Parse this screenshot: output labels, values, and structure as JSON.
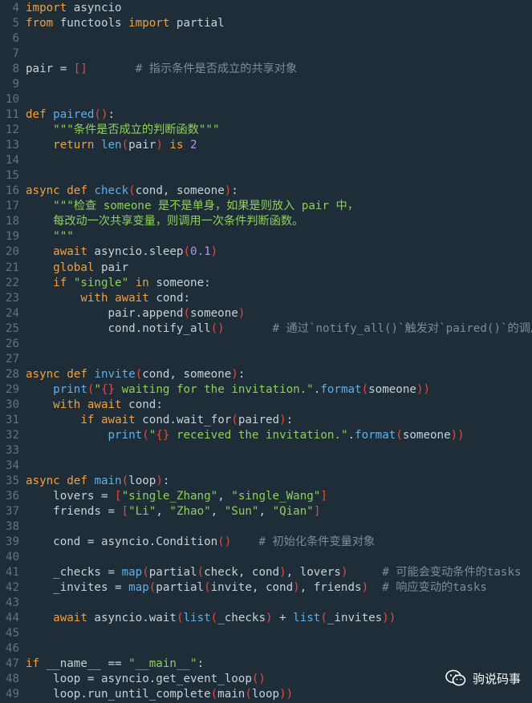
{
  "editor": {
    "language": "python",
    "lines": [
      {
        "n": "4",
        "tokens": [
          {
            "t": "import",
            "c": "kw"
          },
          {
            "t": " asyncio",
            "c": "code"
          }
        ]
      },
      {
        "n": "5",
        "tokens": [
          {
            "t": "from",
            "c": "kw"
          },
          {
            "t": " functools ",
            "c": "code"
          },
          {
            "t": "import",
            "c": "kw"
          },
          {
            "t": " partial",
            "c": "code"
          }
        ]
      },
      {
        "n": "6",
        "tokens": []
      },
      {
        "n": "7",
        "tokens": []
      },
      {
        "n": "8",
        "tokens": [
          {
            "t": "pair = ",
            "c": "code"
          },
          {
            "t": "[]",
            "c": "br"
          },
          {
            "t": "       ",
            "c": "code"
          },
          {
            "t": "# 指示条件是否成立的共享对象",
            "c": "cmt"
          }
        ]
      },
      {
        "n": "9",
        "tokens": []
      },
      {
        "n": "10",
        "tokens": []
      },
      {
        "n": "11",
        "tokens": [
          {
            "t": "def",
            "c": "kw"
          },
          {
            "t": " ",
            "c": "code"
          },
          {
            "t": "paired",
            "c": "fn"
          },
          {
            "t": "()",
            "c": "br"
          },
          {
            "t": ":",
            "c": "code"
          }
        ]
      },
      {
        "n": "12",
        "tokens": [
          {
            "t": "    ",
            "c": "code"
          },
          {
            "t": "\"\"\"条件是否成立的判断函数\"\"\"",
            "c": "str"
          }
        ]
      },
      {
        "n": "13",
        "tokens": [
          {
            "t": "    ",
            "c": "code"
          },
          {
            "t": "return",
            "c": "kw"
          },
          {
            "t": " ",
            "c": "code"
          },
          {
            "t": "len",
            "c": "fn"
          },
          {
            "t": "(",
            "c": "br"
          },
          {
            "t": "pair",
            "c": "code"
          },
          {
            "t": ")",
            "c": "br"
          },
          {
            "t": " ",
            "c": "code"
          },
          {
            "t": "is",
            "c": "kw"
          },
          {
            "t": " ",
            "c": "code"
          },
          {
            "t": "2",
            "c": "num"
          }
        ]
      },
      {
        "n": "14",
        "tokens": []
      },
      {
        "n": "15",
        "tokens": []
      },
      {
        "n": "16",
        "tokens": [
          {
            "t": "async",
            "c": "kw"
          },
          {
            "t": " ",
            "c": "code"
          },
          {
            "t": "def",
            "c": "kw"
          },
          {
            "t": " ",
            "c": "code"
          },
          {
            "t": "check",
            "c": "fn"
          },
          {
            "t": "(",
            "c": "br"
          },
          {
            "t": "cond, someone",
            "c": "code"
          },
          {
            "t": ")",
            "c": "br"
          },
          {
            "t": ":",
            "c": "code"
          }
        ]
      },
      {
        "n": "17",
        "tokens": [
          {
            "t": "    ",
            "c": "code"
          },
          {
            "t": "\"\"\"检查 someone 是不是单身，如果是则放入 pair 中，",
            "c": "str"
          }
        ]
      },
      {
        "n": "18",
        "tokens": [
          {
            "t": "    ",
            "c": "code"
          },
          {
            "t": "每改动一次共享变量，则调用一次条件判断函数。",
            "c": "str"
          }
        ]
      },
      {
        "n": "19",
        "tokens": [
          {
            "t": "    ",
            "c": "code"
          },
          {
            "t": "\"\"\"",
            "c": "str"
          }
        ]
      },
      {
        "n": "20",
        "tokens": [
          {
            "t": "    ",
            "c": "code"
          },
          {
            "t": "await",
            "c": "kw"
          },
          {
            "t": " asyncio.sleep",
            "c": "code"
          },
          {
            "t": "(",
            "c": "br"
          },
          {
            "t": "0.1",
            "c": "num"
          },
          {
            "t": ")",
            "c": "br"
          }
        ]
      },
      {
        "n": "21",
        "tokens": [
          {
            "t": "    ",
            "c": "code"
          },
          {
            "t": "global",
            "c": "kw"
          },
          {
            "t": " pair",
            "c": "code"
          }
        ]
      },
      {
        "n": "22",
        "tokens": [
          {
            "t": "    ",
            "c": "code"
          },
          {
            "t": "if",
            "c": "kw"
          },
          {
            "t": " ",
            "c": "code"
          },
          {
            "t": "\"single\"",
            "c": "str"
          },
          {
            "t": " ",
            "c": "code"
          },
          {
            "t": "in",
            "c": "kw"
          },
          {
            "t": " someone:",
            "c": "code"
          }
        ]
      },
      {
        "n": "23",
        "tokens": [
          {
            "t": "        ",
            "c": "code"
          },
          {
            "t": "with",
            "c": "kw"
          },
          {
            "t": " ",
            "c": "code"
          },
          {
            "t": "await",
            "c": "kw"
          },
          {
            "t": " cond:",
            "c": "code"
          }
        ]
      },
      {
        "n": "24",
        "tokens": [
          {
            "t": "            pair.append",
            "c": "code"
          },
          {
            "t": "(",
            "c": "br"
          },
          {
            "t": "someone",
            "c": "code"
          },
          {
            "t": ")",
            "c": "br"
          }
        ]
      },
      {
        "n": "25",
        "tokens": [
          {
            "t": "            cond.notify_all",
            "c": "code"
          },
          {
            "t": "()",
            "c": "br"
          },
          {
            "t": "       ",
            "c": "code"
          },
          {
            "t": "# 通过`notify_all()`触发对`paired()`的调用",
            "c": "cmt"
          }
        ]
      },
      {
        "n": "26",
        "tokens": []
      },
      {
        "n": "27",
        "tokens": []
      },
      {
        "n": "28",
        "tokens": [
          {
            "t": "async",
            "c": "kw"
          },
          {
            "t": " ",
            "c": "code"
          },
          {
            "t": "def",
            "c": "kw"
          },
          {
            "t": " ",
            "c": "code"
          },
          {
            "t": "invite",
            "c": "fn"
          },
          {
            "t": "(",
            "c": "br"
          },
          {
            "t": "cond, someone",
            "c": "code"
          },
          {
            "t": ")",
            "c": "br"
          },
          {
            "t": ":",
            "c": "code"
          }
        ]
      },
      {
        "n": "29",
        "tokens": [
          {
            "t": "    ",
            "c": "code"
          },
          {
            "t": "print",
            "c": "fn"
          },
          {
            "t": "(",
            "c": "br"
          },
          {
            "t": "\"",
            "c": "str"
          },
          {
            "t": "{}",
            "c": "br"
          },
          {
            "t": " waiting for the invitation.\"",
            "c": "str"
          },
          {
            "t": ".",
            "c": "code"
          },
          {
            "t": "format",
            "c": "fn"
          },
          {
            "t": "(",
            "c": "br"
          },
          {
            "t": "someone",
            "c": "code"
          },
          {
            "t": "))",
            "c": "br"
          }
        ]
      },
      {
        "n": "30",
        "tokens": [
          {
            "t": "    ",
            "c": "code"
          },
          {
            "t": "with",
            "c": "kw"
          },
          {
            "t": " ",
            "c": "code"
          },
          {
            "t": "await",
            "c": "kw"
          },
          {
            "t": " cond:",
            "c": "code"
          }
        ]
      },
      {
        "n": "31",
        "tokens": [
          {
            "t": "        ",
            "c": "code"
          },
          {
            "t": "if",
            "c": "kw"
          },
          {
            "t": " ",
            "c": "code"
          },
          {
            "t": "await",
            "c": "kw"
          },
          {
            "t": " cond.wait_for",
            "c": "code"
          },
          {
            "t": "(",
            "c": "br"
          },
          {
            "t": "paired",
            "c": "code"
          },
          {
            "t": ")",
            "c": "br"
          },
          {
            "t": ":",
            "c": "code"
          }
        ]
      },
      {
        "n": "32",
        "tokens": [
          {
            "t": "            ",
            "c": "code"
          },
          {
            "t": "print",
            "c": "fn"
          },
          {
            "t": "(",
            "c": "br"
          },
          {
            "t": "\"",
            "c": "str"
          },
          {
            "t": "{}",
            "c": "br"
          },
          {
            "t": " received the invitation.\"",
            "c": "str"
          },
          {
            "t": ".",
            "c": "code"
          },
          {
            "t": "format",
            "c": "fn"
          },
          {
            "t": "(",
            "c": "br"
          },
          {
            "t": "someone",
            "c": "code"
          },
          {
            "t": "))",
            "c": "br"
          }
        ]
      },
      {
        "n": "33",
        "tokens": []
      },
      {
        "n": "34",
        "tokens": []
      },
      {
        "n": "35",
        "tokens": [
          {
            "t": "async",
            "c": "kw"
          },
          {
            "t": " ",
            "c": "code"
          },
          {
            "t": "def",
            "c": "kw"
          },
          {
            "t": " ",
            "c": "code"
          },
          {
            "t": "main",
            "c": "fn"
          },
          {
            "t": "(",
            "c": "br"
          },
          {
            "t": "loop",
            "c": "code"
          },
          {
            "t": ")",
            "c": "br"
          },
          {
            "t": ":",
            "c": "code"
          }
        ]
      },
      {
        "n": "36",
        "tokens": [
          {
            "t": "    lovers = ",
            "c": "code"
          },
          {
            "t": "[",
            "c": "br"
          },
          {
            "t": "\"single_Zhang\"",
            "c": "str"
          },
          {
            "t": ", ",
            "c": "code"
          },
          {
            "t": "\"single_Wang\"",
            "c": "str"
          },
          {
            "t": "]",
            "c": "br"
          }
        ]
      },
      {
        "n": "37",
        "tokens": [
          {
            "t": "    friends = ",
            "c": "code"
          },
          {
            "t": "[",
            "c": "br"
          },
          {
            "t": "\"Li\"",
            "c": "str"
          },
          {
            "t": ", ",
            "c": "code"
          },
          {
            "t": "\"Zhao\"",
            "c": "str"
          },
          {
            "t": ", ",
            "c": "code"
          },
          {
            "t": "\"Sun\"",
            "c": "str"
          },
          {
            "t": ", ",
            "c": "code"
          },
          {
            "t": "\"Qian\"",
            "c": "str"
          },
          {
            "t": "]",
            "c": "br"
          }
        ]
      },
      {
        "n": "38",
        "tokens": []
      },
      {
        "n": "39",
        "tokens": [
          {
            "t": "    cond = asyncio.Condition",
            "c": "code"
          },
          {
            "t": "()",
            "c": "br"
          },
          {
            "t": "    ",
            "c": "code"
          },
          {
            "t": "# 初始化条件变量对象",
            "c": "cmt"
          }
        ]
      },
      {
        "n": "40",
        "tokens": []
      },
      {
        "n": "41",
        "tokens": [
          {
            "t": "    _checks = ",
            "c": "code"
          },
          {
            "t": "map",
            "c": "fn"
          },
          {
            "t": "(",
            "c": "br"
          },
          {
            "t": "partial",
            "c": "code"
          },
          {
            "t": "(",
            "c": "br"
          },
          {
            "t": "check, cond",
            "c": "code"
          },
          {
            "t": ")",
            "c": "br"
          },
          {
            "t": ", lovers",
            "c": "code"
          },
          {
            "t": ")",
            "c": "br"
          },
          {
            "t": "     ",
            "c": "code"
          },
          {
            "t": "# 可能会变动条件的tasks",
            "c": "cmt"
          }
        ]
      },
      {
        "n": "42",
        "tokens": [
          {
            "t": "    _invites = ",
            "c": "code"
          },
          {
            "t": "map",
            "c": "fn"
          },
          {
            "t": "(",
            "c": "br"
          },
          {
            "t": "partial",
            "c": "code"
          },
          {
            "t": "(",
            "c": "br"
          },
          {
            "t": "invite, cond",
            "c": "code"
          },
          {
            "t": ")",
            "c": "br"
          },
          {
            "t": ", friends",
            "c": "code"
          },
          {
            "t": ")",
            "c": "br"
          },
          {
            "t": "  ",
            "c": "code"
          },
          {
            "t": "# 响应变动的tasks",
            "c": "cmt"
          }
        ]
      },
      {
        "n": "43",
        "tokens": []
      },
      {
        "n": "44",
        "tokens": [
          {
            "t": "    ",
            "c": "code"
          },
          {
            "t": "await",
            "c": "kw"
          },
          {
            "t": " asyncio.wait",
            "c": "code"
          },
          {
            "t": "(",
            "c": "br"
          },
          {
            "t": "list",
            "c": "fn"
          },
          {
            "t": "(",
            "c": "br"
          },
          {
            "t": "_checks",
            "c": "code"
          },
          {
            "t": ")",
            "c": "br"
          },
          {
            "t": " + ",
            "c": "code"
          },
          {
            "t": "list",
            "c": "fn"
          },
          {
            "t": "(",
            "c": "br"
          },
          {
            "t": "_invites",
            "c": "code"
          },
          {
            "t": "))",
            "c": "br"
          }
        ]
      },
      {
        "n": "45",
        "tokens": []
      },
      {
        "n": "46",
        "tokens": []
      },
      {
        "n": "47",
        "tokens": [
          {
            "t": "if",
            "c": "kw"
          },
          {
            "t": " __name__ == ",
            "c": "code"
          },
          {
            "t": "\"__main__\"",
            "c": "str"
          },
          {
            "t": ":",
            "c": "code"
          }
        ]
      },
      {
        "n": "48",
        "tokens": [
          {
            "t": "    loop = asyncio.get_event_loop",
            "c": "code"
          },
          {
            "t": "()",
            "c": "br"
          }
        ]
      },
      {
        "n": "49",
        "tokens": [
          {
            "t": "    loop.run_until_complete",
            "c": "code"
          },
          {
            "t": "(",
            "c": "br"
          },
          {
            "t": "main",
            "c": "code"
          },
          {
            "t": "(",
            "c": "br"
          },
          {
            "t": "loop",
            "c": "code"
          },
          {
            "t": "))",
            "c": "br"
          }
        ]
      }
    ]
  },
  "watermark": {
    "text": "驹说码事",
    "icon": "wechat-icon"
  },
  "colors": {
    "background": "#1e2d38",
    "keyword": "#f2a03d",
    "function": "#5fb0e8",
    "string": "#8fd05a",
    "comment": "#7a8d99",
    "number": "#b88ff0",
    "bracket": "#e84a3c",
    "text": "#c9d1d6"
  }
}
